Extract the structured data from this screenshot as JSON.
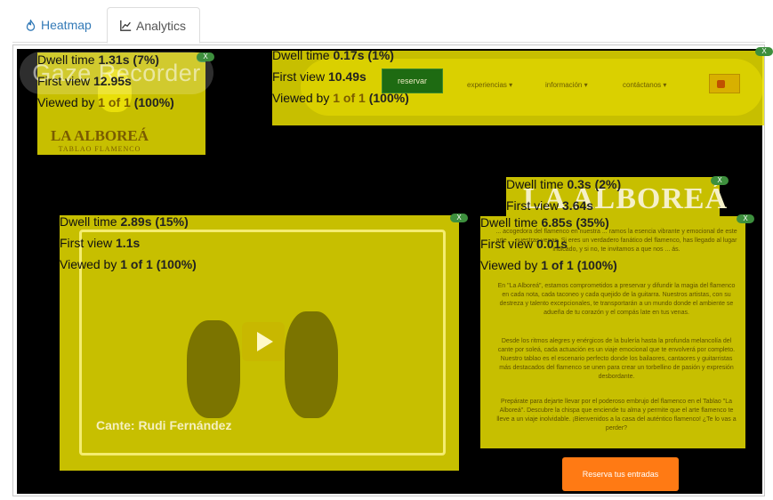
{
  "tabs": [
    {
      "label": "Heatmap",
      "icon": "fire-icon",
      "active": false
    },
    {
      "label": "Analytics",
      "icon": "area-chart-icon",
      "active": true
    }
  ],
  "overlay": {
    "gaze_label": "Gaze Recorder"
  },
  "site": {
    "reservar_label": "reservar",
    "nav_links": [
      "experiencias ▾",
      "información ▾",
      "contáctanos ▾"
    ],
    "logo_title": "LA ALBOREÁ",
    "logo_subtitle": "TABLAO FLAMENCO",
    "big_logo": "LA ALBOREÁ",
    "video_caption": "Cante: Rudi Fernández",
    "reserva_button": "Reserva tus entradas",
    "paragraphs": [
      "... acogedora del flamenco en nuestra ... ramos la esencia vibrante y emocional de este arte ... nuestras venas. Si eres un verdadero fanático del flamenco, has llegado al lugar indicado, y si no, te invitamos a que nos ... ás.",
      "En \"La Alboreá\", estamos comprometidos a preservar y difundir la magia del flamenco en cada nota, cada taconeo y cada quejido de la guitarra. Nuestros artistas, con su destreza y talento excepcionales, te transportarán a un mundo donde el ambiente se adueña de tu corazón y el compás late en tus venas.",
      "Desde los ritmos alegres y enérgicos de la bulería hasta la profunda melancolía del cante por soleá, cada actuación es un viaje emocional que te envolverá por completo. Nuestro tablao es el escenario perfecto donde los bailaores, cantaores y guitarristas más destacados del flamenco se unen para crear un torbellino de pasión y expresión desbordante.",
      "Prepárate para dejarte llevar por el poderoso embrujo del flamenco en el Tablao \"La Alboreá\". Descubre la chispa que enciende tu alma y permite que el arte flamenco te lleve a un viaje inolvidable. ¡Bienvenidos a la casa del auténtico flamenco! ¿Te lo vas a perder?"
    ]
  },
  "labels": {
    "dwell": "Dwell time",
    "first": "First view",
    "viewed": "Viewed by",
    "close": "X"
  },
  "aois": [
    {
      "name": "logo",
      "dwell": "1.31s",
      "dwell_pct": "(7%)",
      "first": "12.95s",
      "viewed": "1 of 1",
      "viewed_pct": "(100%)"
    },
    {
      "name": "header-nav",
      "dwell": "0.17s",
      "dwell_pct": "(1%)",
      "first": "10.49s",
      "viewed": "1 of 1",
      "viewed_pct": "(100%)"
    },
    {
      "name": "big-logo",
      "dwell": "0.3s",
      "dwell_pct": "(2%)",
      "first": "3.64s",
      "viewed": "",
      "viewed_pct": ""
    },
    {
      "name": "video",
      "dwell": "2.89s",
      "dwell_pct": "(15%)",
      "first": "1.1s",
      "viewed": "1 of 1",
      "viewed_pct": "(100%)"
    },
    {
      "name": "text-block",
      "dwell": "6.85s",
      "dwell_pct": "(35%)",
      "first": "0.01s",
      "viewed": "1 of 1",
      "viewed_pct": "(100%)"
    }
  ],
  "colors": {
    "aoi_fill": "#e8de00",
    "close_badge": "#3d8f3d",
    "tab_active_text": "#555555",
    "tab_link": "#337ab7",
    "cta": "#ff7a14"
  }
}
